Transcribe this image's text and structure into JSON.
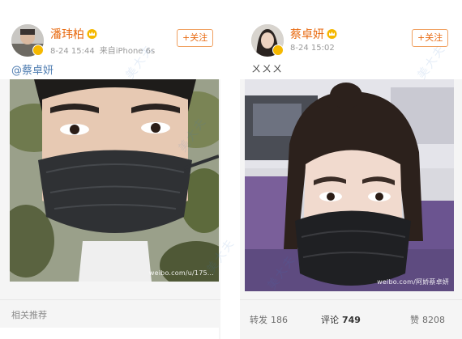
{
  "left_post": {
    "username": "潘玮柏",
    "timestamp": "8-24 15:44",
    "source": "来自iPhone 6s",
    "follow_label": "+关注",
    "text": "@蔡卓妍",
    "photo_watermark": "weibo.com/u/175...",
    "footer_label": "相关推荐"
  },
  "right_post": {
    "username": "蔡卓妍",
    "timestamp": "8-24 15:02",
    "follow_label": "+关注",
    "text": "ㄨㄨㄨ",
    "photo_watermark": "weibo.com/阿娇蔡卓妍",
    "repost_label": "转发",
    "repost_count": "186",
    "comment_label": "评论",
    "comment_count": "749",
    "like_label": "赞",
    "like_count": "8208"
  },
  "page_watermark": "美大夫",
  "colors": {
    "username": "#e86a10",
    "mention": "#4f7db1",
    "badge": "#f5b800",
    "page_background": "#f5f5f5"
  },
  "icons": {
    "verified": "verified-badge-icon",
    "crown": "crown-icon",
    "like": "thumbs-up-icon"
  }
}
